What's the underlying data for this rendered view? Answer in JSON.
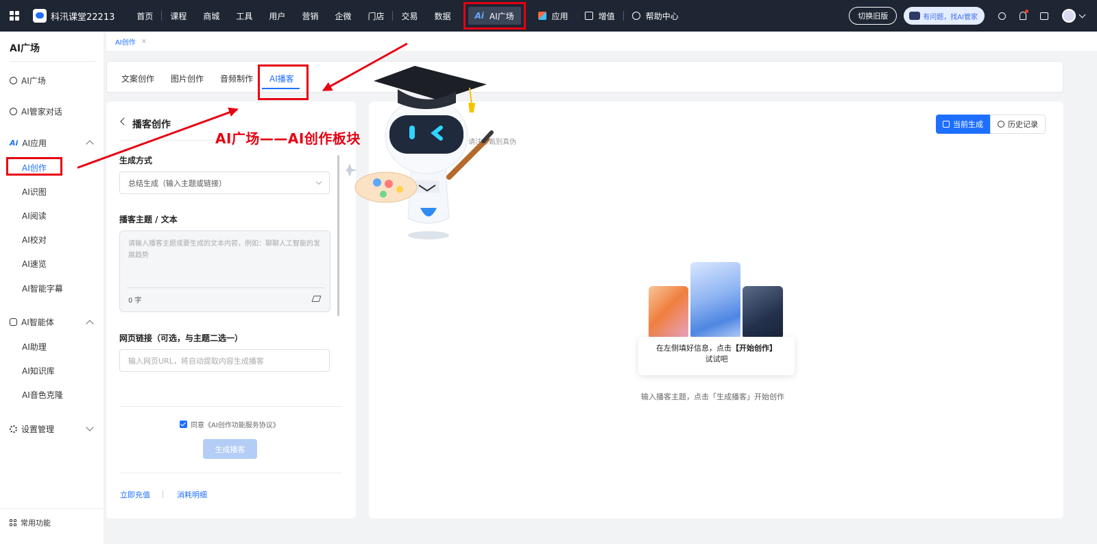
{
  "topnav": {
    "brand": "科汛课堂22213",
    "items": [
      "首页",
      "课程",
      "商城",
      "工具",
      "用户",
      "营销",
      "企微",
      "门店",
      "交易",
      "数据"
    ],
    "ai_mark": "Ai",
    "ai_plaza": "AI广场",
    "apps": "应用",
    "value_added": "增值",
    "help": "帮助中心",
    "switch_old": "切换旧版",
    "helper": "有问题，找AI管家"
  },
  "sidebar": {
    "title": "AI广场",
    "plaza": "AI广场",
    "butler": "AI管家对话",
    "ai_mark": "Ai",
    "apps": "AI应用",
    "app_items": [
      "AI创作",
      "AI识图",
      "AI阅读",
      "AI校对",
      "AI速览",
      "AI智能字幕"
    ],
    "agents": "AI智能体",
    "agent_items": [
      "AI助理",
      "AI知识库",
      "AI音色克隆"
    ],
    "settings": "设置管理",
    "common": "常用功能"
  },
  "breadcrumb": {
    "tab": "AI创作",
    "close": "×"
  },
  "tabs": [
    "文案创作",
    "图片创作",
    "音频制作",
    "AI播客"
  ],
  "left_panel": {
    "title": "播客创作",
    "mode_label": "生成方式",
    "mode_value": "总结生成（输入主题或链接）",
    "topic_label": "播客主题 / 文本",
    "topic_placeholder": "请输入播客主题或要生成的文本内容，例如：聊聊人工智能的发展趋势",
    "char_count": "0 字",
    "url_label": "网页链接（可选，与主题二选一）",
    "url_placeholder": "输入网页URL，将自动提取内容生成播客",
    "agree": "同意《AI创作功能服务协议》",
    "generate": "生成播客",
    "recharge": "立即充值",
    "consumption": "消耗明细"
  },
  "right_panel": {
    "current": "当前生成",
    "history": "历史记录",
    "subtitle": "，请注意甄别真伪",
    "tip_line1_a": "在左侧填好信息，点击",
    "tip_line1_b": "【开始创作】",
    "tip_line2": "试试吧",
    "hint": "输入播客主题，点击「生成播客」开始创作"
  },
  "annotation": {
    "text": "AI广场——AI创作板块"
  },
  "colors": {
    "accent": "#1e6fff",
    "annotation": "#e60012",
    "nav_bg": "#1e2533"
  }
}
